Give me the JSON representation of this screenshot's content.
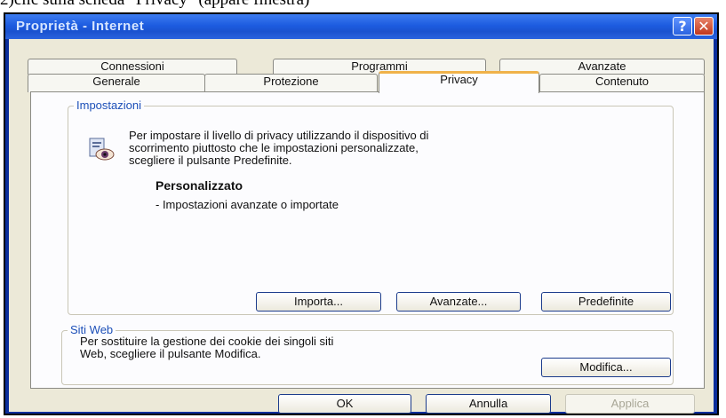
{
  "caption": "2)clic sulla scheda \"Privacy\" (appare finestra)",
  "window": {
    "title": "Proprietà - Internet",
    "help_glyph": "?",
    "close_glyph": "✕"
  },
  "tabs": {
    "row1": [
      "Connessioni",
      "Programmi",
      "Avanzate"
    ],
    "row2": [
      "Generale",
      "Protezione",
      "Privacy",
      "Contenuto"
    ],
    "active": "Privacy"
  },
  "impostazioni": {
    "label": "Impostazioni",
    "description_lines": [
      "Per impostare il livello di privacy utilizzando il dispositivo di",
      "scorrimento piuttosto che le impostazioni personalizzate,",
      "scegliere il pulsante Predefinite."
    ],
    "level_title": "Personalizzato",
    "level_detail": "- Impostazioni avanzate o importate",
    "buttons": [
      "Importa...",
      "Avanzate...",
      "Predefinite"
    ],
    "icon": "privacy-eye-icon"
  },
  "siti_web": {
    "label": "Siti Web",
    "description_lines": [
      "Per sostituire la gestione dei cookie dei singoli siti",
      "Web, scegliere il pulsante Modifica."
    ],
    "button": "Modifica..."
  },
  "footer_buttons": {
    "ok": "OK",
    "cancel": "Annulla",
    "apply": "Applica"
  }
}
